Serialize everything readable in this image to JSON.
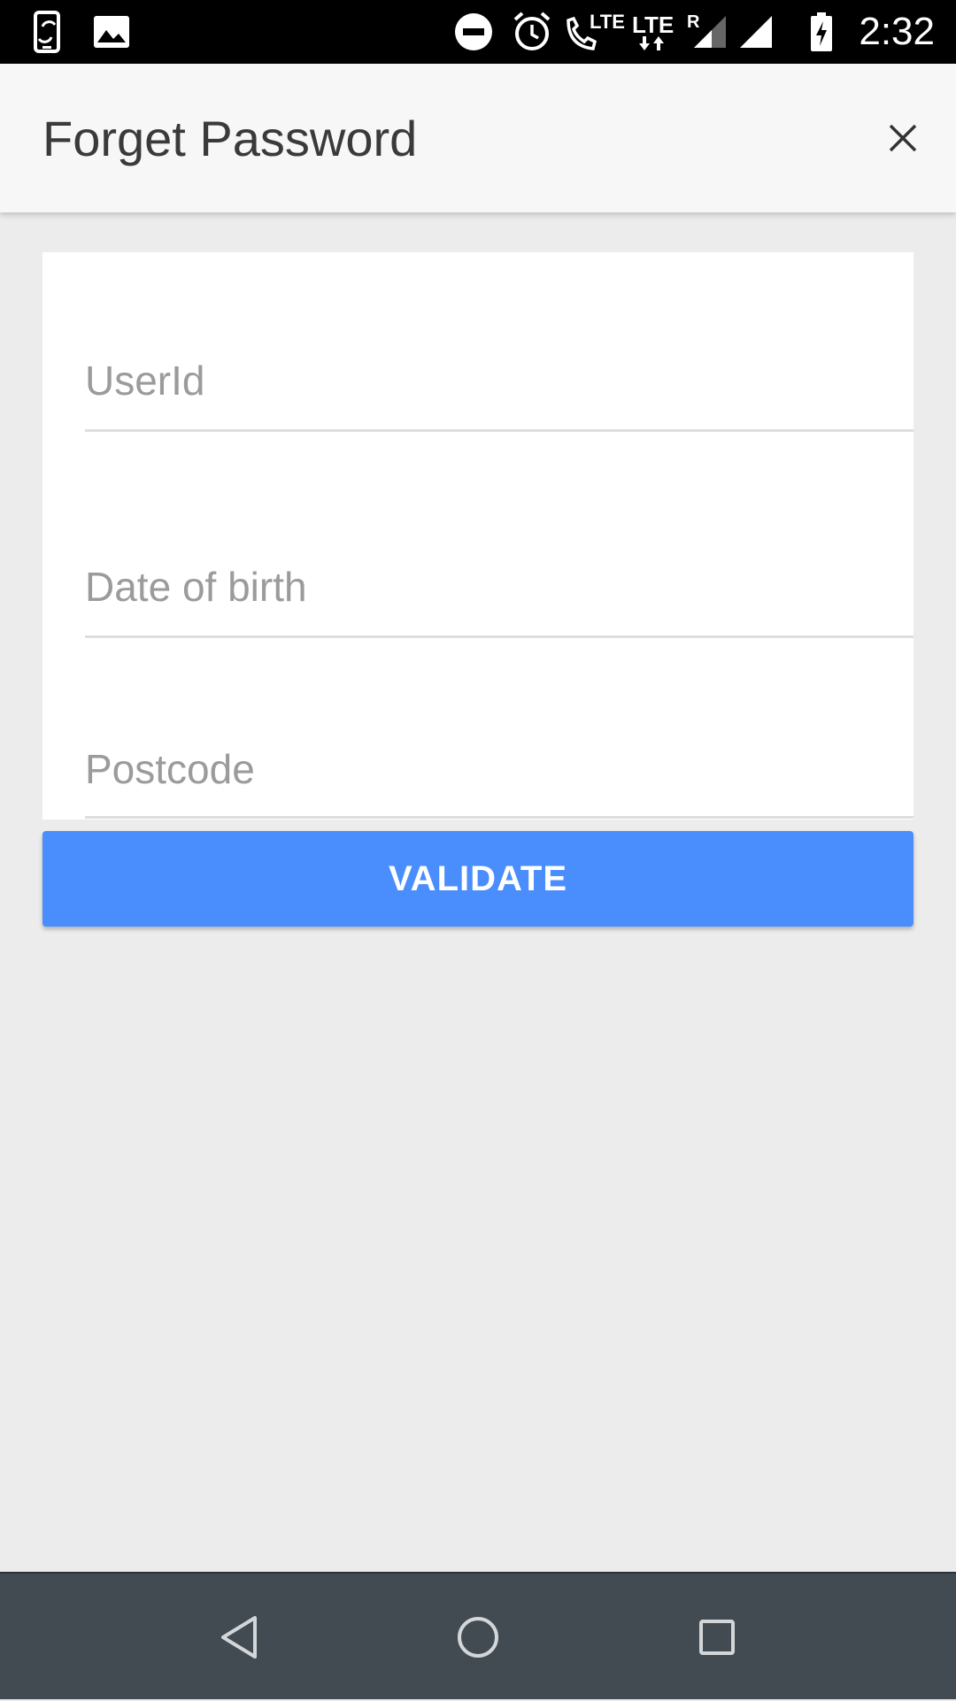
{
  "status_bar": {
    "time": "2:32",
    "lte_label_1": "LTE",
    "lte_label_2": "LTE",
    "roaming_label": "R",
    "icons": [
      "screen-rotate-icon",
      "image-icon",
      "do-not-disturb-icon",
      "alarm-icon",
      "volte-call-icon",
      "lte-data-icon",
      "signal-roaming-icon",
      "signal-icon",
      "battery-charging-icon"
    ]
  },
  "header": {
    "title": "Forget Password",
    "close_icon": "close-icon"
  },
  "form": {
    "userid": {
      "value": "",
      "placeholder": "UserId"
    },
    "dob": {
      "value": "",
      "placeholder": "Date of birth"
    },
    "postcode": {
      "value": "",
      "placeholder": "Postcode"
    }
  },
  "validate_button": {
    "label": "VALIDATE",
    "color": "#4a8dfc"
  },
  "nav_bar": {
    "icons": [
      "back-icon",
      "home-icon",
      "recents-icon"
    ]
  }
}
